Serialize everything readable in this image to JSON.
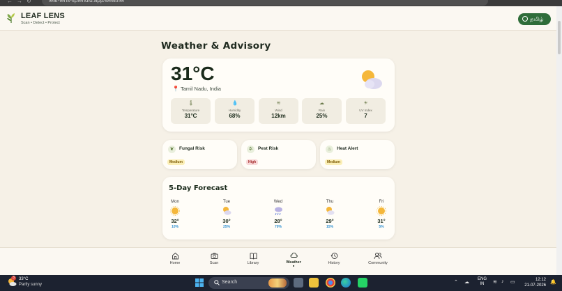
{
  "browser": {
    "url": "leaf-lens-splendid.app/weather"
  },
  "brand": {
    "name": "LEAF LENS",
    "tagline": "Scan • Detect • Protect"
  },
  "language_button": {
    "label": "தமிழ்"
  },
  "page": {
    "title": "Weather & Advisory"
  },
  "current": {
    "temperature": "31°C",
    "location": "Tamil Nadu, India",
    "condition_icon": "partly-cloudy-icon",
    "stats": [
      {
        "label": "Temperature",
        "value": "31°C",
        "icon": "thermometer-icon"
      },
      {
        "label": "Humidity",
        "value": "68%",
        "icon": "droplet-icon"
      },
      {
        "label": "Wind",
        "value": "12km",
        "icon": "wind-icon"
      },
      {
        "label": "Rain",
        "value": "25%",
        "icon": "rain-cloud-icon"
      },
      {
        "label": "UV Index",
        "value": "7",
        "icon": "sun-icon"
      }
    ]
  },
  "risks": [
    {
      "name": "Fungal Risk",
      "level": "Medium",
      "icon": "leaf-icon",
      "color": "#fbefb7"
    },
    {
      "name": "Pest Risk",
      "level": "High",
      "icon": "bug-icon",
      "color": "#f8d8d8"
    },
    {
      "name": "Heat Alert",
      "level": "Medium",
      "icon": "thermometer-icon",
      "color": "#fbefb7"
    }
  ],
  "forecast": {
    "title": "5-Day Forecast",
    "days": [
      {
        "day": "Mon",
        "temp": "32°",
        "rain": "10%",
        "icon": "sun-icon"
      },
      {
        "day": "Tue",
        "temp": "30°",
        "rain": "25%",
        "icon": "partly-cloudy-icon"
      },
      {
        "day": "Wed",
        "temp": "28°",
        "rain": "70%",
        "icon": "rain-icon"
      },
      {
        "day": "Thu",
        "temp": "29°",
        "rain": "15%",
        "icon": "partly-cloudy-icon"
      },
      {
        "day": "Fri",
        "temp": "31°",
        "rain": "5%",
        "icon": "sun-icon"
      }
    ]
  },
  "bottom_nav": [
    {
      "label": "Home",
      "icon": "home-icon",
      "active": false
    },
    {
      "label": "Scan",
      "icon": "camera-icon",
      "active": false
    },
    {
      "label": "Library",
      "icon": "book-icon",
      "active": false
    },
    {
      "label": "Weather",
      "icon": "cloud-icon",
      "active": true
    },
    {
      "label": "History",
      "icon": "history-icon",
      "active": false
    },
    {
      "label": "Community",
      "icon": "people-icon",
      "active": false
    }
  ],
  "taskbar": {
    "weather_temp": "33°C",
    "weather_condition": "Partly sunny",
    "weather_badge": "3",
    "search_placeholder": "Search",
    "language": "ENG",
    "region": "IN",
    "time": "12:12",
    "date": "21-07-2026"
  },
  "colors": {
    "accent": "#2f6d3a",
    "background": "#f6f1e7",
    "card": "#fffdf8",
    "rain_text": "#2d8fd1"
  }
}
